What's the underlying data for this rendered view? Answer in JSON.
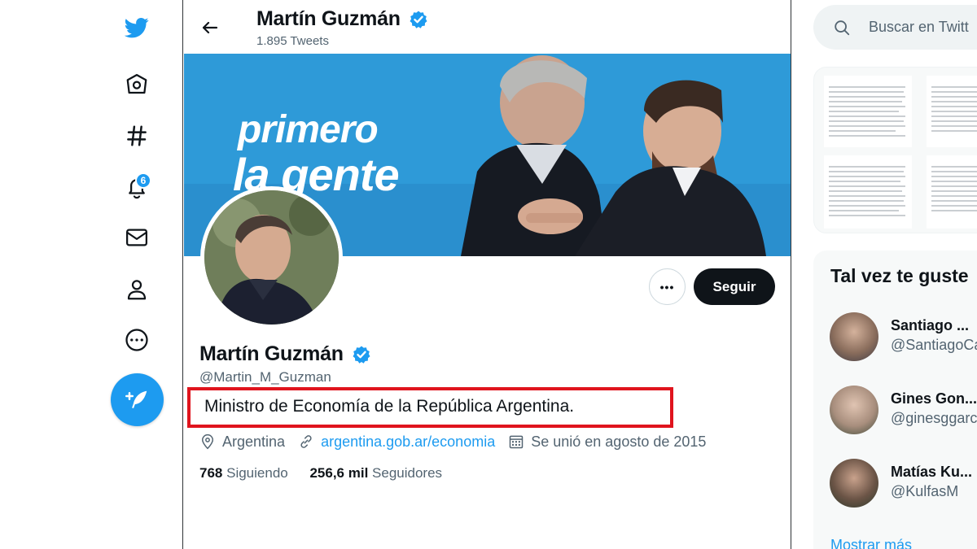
{
  "profile": {
    "topbar_name": "Martín Guzmán",
    "tweet_count": "1.895 Tweets",
    "name": "Martín Guzmán",
    "handle": "@Martin_M_Guzman",
    "bio": "Ministro de Economía de la República Argentina.",
    "location": "Argentina",
    "website": "argentina.gob.ar/economia",
    "joined": "Se unió en agosto de 2015",
    "following_count": "768",
    "following_label": "Siguiendo",
    "followers_count": "256,6 mil",
    "followers_label": "Seguidores",
    "follow_button": "Seguir",
    "more_button": "•••"
  },
  "banner": {
    "line1": "primero",
    "line2": "la gente"
  },
  "nav": {
    "notifications_badge": "6",
    "icons": [
      "twitter-logo-icon",
      "home-icon",
      "explore-hashtag-icon",
      "notifications-bell-icon",
      "messages-envelope-icon",
      "profile-person-icon",
      "more-circle-icon"
    ]
  },
  "search": {
    "placeholder": "Buscar en Twitt"
  },
  "suggestions": {
    "title": "Tal vez te guste",
    "items": [
      {
        "name": "Santiago ...",
        "handle": "@SantiagoCa"
      },
      {
        "name": "Gines Gon...",
        "handle": "@ginesggarc"
      },
      {
        "name": "Matías Ku...",
        "handle": "@KulfasM"
      }
    ],
    "show_more": "Mostrar más"
  },
  "colors": {
    "accent": "#1d9bf0",
    "highlight_box": "#e0141d",
    "text_primary": "#0f1419",
    "text_secondary": "#536471"
  }
}
